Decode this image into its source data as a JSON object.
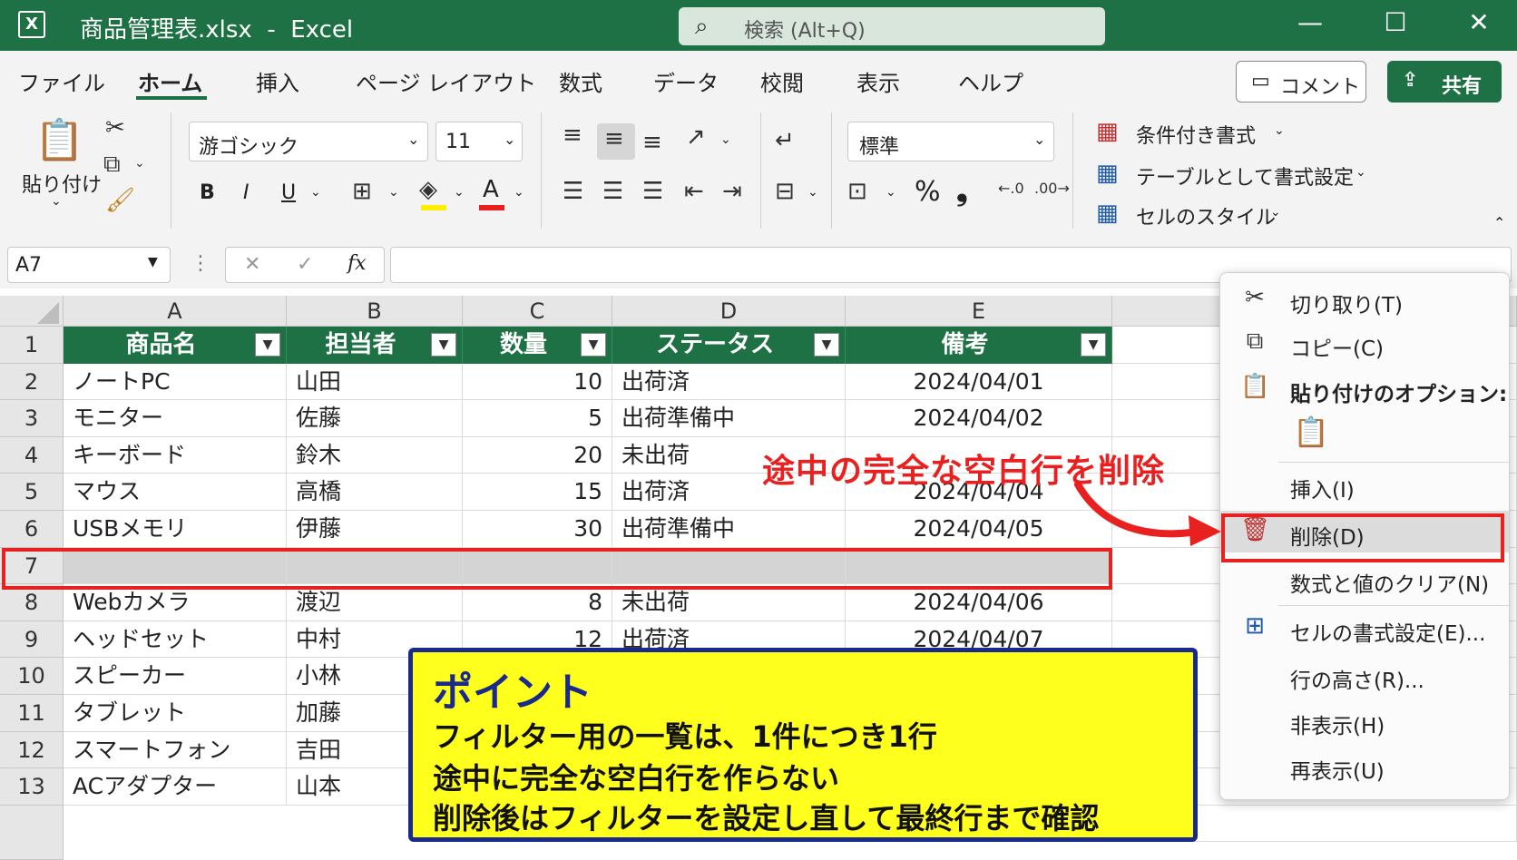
{
  "window": {
    "app_icon": "X",
    "title": "商品管理表.xlsx  -  Excel",
    "search_icon": "search-icon",
    "search_placeholder": "検索 (Alt+Q)",
    "controls": {
      "minimize": "—",
      "maximize": "☐",
      "close": "✕"
    }
  },
  "ribbon_tabs": [
    "ファイル",
    "ホーム",
    "挿入",
    "ページ レイアウト",
    "数式",
    "データ",
    "校閲",
    "表示",
    "ヘルプ"
  ],
  "active_tab": "ホーム",
  "comment_button": "コメント",
  "share_button": "共有",
  "ribbon": {
    "paste_label": "貼り付け",
    "font_name": "游ゴシック",
    "font_size": "11",
    "bold": "B",
    "italic": "I",
    "underline": "U",
    "number_format": "標準",
    "percent": "%",
    "comma": "❟",
    "conditional_format": "条件付き書式",
    "format_as_table": "テーブルとして書式設定",
    "cell_styles": "セルのスタイル"
  },
  "formula_bar": {
    "name_box": "A7",
    "cancel": "✕",
    "enter": "✓",
    "fx": "fx",
    "value": ""
  },
  "columns": [
    "A",
    "B",
    "C",
    "D",
    "E"
  ],
  "table_headers": [
    "商品名",
    "担当者",
    "数量",
    "ステータス",
    "備考"
  ],
  "row_numbers": [
    "1",
    "2",
    "3",
    "4",
    "5",
    "6",
    "7",
    "8",
    "9",
    "10",
    "11",
    "12",
    "13"
  ],
  "rows": [
    {
      "name": "ノートPC",
      "owner": "山田",
      "qty": "10",
      "status": "出荷済",
      "note": "2024/04/01"
    },
    {
      "name": "モニター",
      "owner": "佐藤",
      "qty": "5",
      "status": "出荷準備中",
      "note": "2024/04/02"
    },
    {
      "name": "キーボード",
      "owner": "鈴木",
      "qty": "20",
      "status": "未出荷",
      "note": ""
    },
    {
      "name": "マウス",
      "owner": "高橋",
      "qty": "15",
      "status": "出荷済",
      "note": "2024/04/04"
    },
    {
      "name": "USBメモリ",
      "owner": "伊藤",
      "qty": "30",
      "status": "出荷準備中",
      "note": "2024/04/05"
    },
    {
      "name": "",
      "owner": "",
      "qty": "",
      "status": "",
      "note": ""
    },
    {
      "name": "Webカメラ",
      "owner": "渡辺",
      "qty": "8",
      "status": "未出荷",
      "note": "2024/04/06"
    },
    {
      "name": "ヘッドセット",
      "owner": "中村",
      "qty": "12",
      "status": "出荷済",
      "note": "2024/04/07"
    },
    {
      "name": "スピーカー",
      "owner": "小林",
      "qty": "",
      "status": "",
      "note": ""
    },
    {
      "name": "タブレット",
      "owner": "加藤",
      "qty": "",
      "status": "",
      "note": ""
    },
    {
      "name": "スマートフォン",
      "owner": "吉田",
      "qty": "",
      "status": "",
      "note": ""
    },
    {
      "name": "ACアダプター",
      "owner": "山本",
      "qty": "",
      "status": "",
      "note": ""
    }
  ],
  "context_menu": {
    "cut": "切り取り(T)",
    "copy": "コピー(C)",
    "paste_options": "貼り付けのオプション:",
    "insert": "挿入(I)",
    "delete": "削除(D)",
    "clear": "数式と値のクリア(N)",
    "format_cells": "セルの書式設定(E)...",
    "row_height": "行の高さ(R)...",
    "hide": "非表示(H)",
    "unhide": "再表示(U)"
  },
  "annotation": {
    "callout": "途中の完全な空白行を削除",
    "point_title": "ポイント",
    "point_lines": [
      "フィルター用の一覧は、1件につき1行",
      "途中に完全な空白行を作らない",
      "削除後はフィルターを設定し直して最終行まで確認"
    ]
  },
  "colors": {
    "excel_green": "#1e7145",
    "highlight_red": "#e82020",
    "point_yellow": "#ffff1e",
    "point_border": "#1a2a8a"
  }
}
